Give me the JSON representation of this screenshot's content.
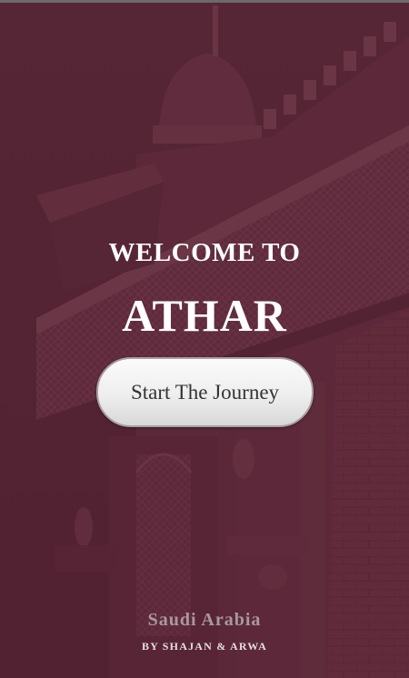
{
  "theme": {
    "overlay_color": "#5a2a3a",
    "text_color": "#ffffff",
    "button_text_color": "#333333",
    "footer_muted_color": "#a8999f"
  },
  "background": {
    "icon": "historic-building-illustration"
  },
  "hero": {
    "welcome": "WELCOME TO",
    "title": "ATHAR"
  },
  "actions": {
    "start_label": "Start The Journey"
  },
  "footer": {
    "country": "Saudi Arabia",
    "credits": "BY SHAJAN & ARWA"
  }
}
